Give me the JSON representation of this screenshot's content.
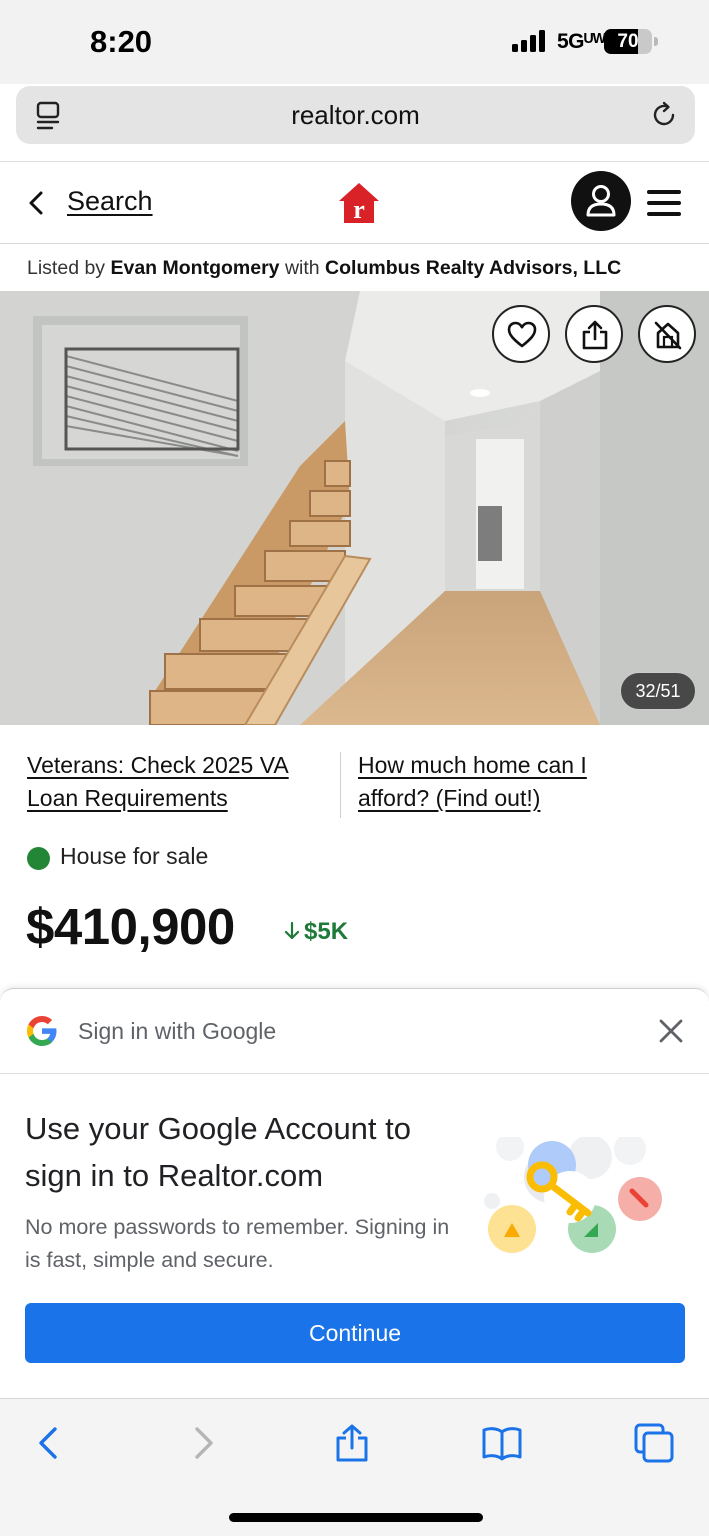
{
  "status_bar": {
    "time": "8:20",
    "network": "5Gᵁᵂ",
    "battery": "70",
    "battery_level": 0.7
  },
  "browser": {
    "url": "realtor.com",
    "reader_icon": "reader-mode-icon",
    "reload_icon": "reload-icon"
  },
  "header": {
    "back_label": "Search",
    "logo_icon": "realtor-logo-icon",
    "account_icon": "person-icon",
    "menu_icon": "hamburger-menu-icon"
  },
  "listing": {
    "listed_by_prefix": "Listed by",
    "agent": "Evan Montgomery",
    "with_text": "with",
    "brokerage": "Columbus Realty Advisors, LLC",
    "photo_counter": "32/51",
    "promo_links": [
      {
        "label": "Veterans: Check 2025 VA Loan Requirements"
      },
      {
        "label": "How much home can I afford? (Find out!)"
      }
    ],
    "status": "House for sale",
    "status_color": "#238636",
    "price": "$410,900",
    "price_change": "$5K",
    "price_change_direction": "down",
    "price_change_color": "#1f7a3a"
  },
  "photo_actions": [
    "heart-icon",
    "share-icon",
    "hide-icon"
  ],
  "google_sheet": {
    "title": "Sign in with Google",
    "heading": "Use your Google Account to sign in to Realtor.com",
    "body": "No more passwords to remember. Signing in is fast, simple and secure.",
    "button": "Continue",
    "button_color": "#1a73e8"
  },
  "toolbar": {
    "items": [
      "back-icon",
      "forward-icon",
      "share-icon",
      "bookmarks-icon",
      "tabs-icon"
    ]
  }
}
